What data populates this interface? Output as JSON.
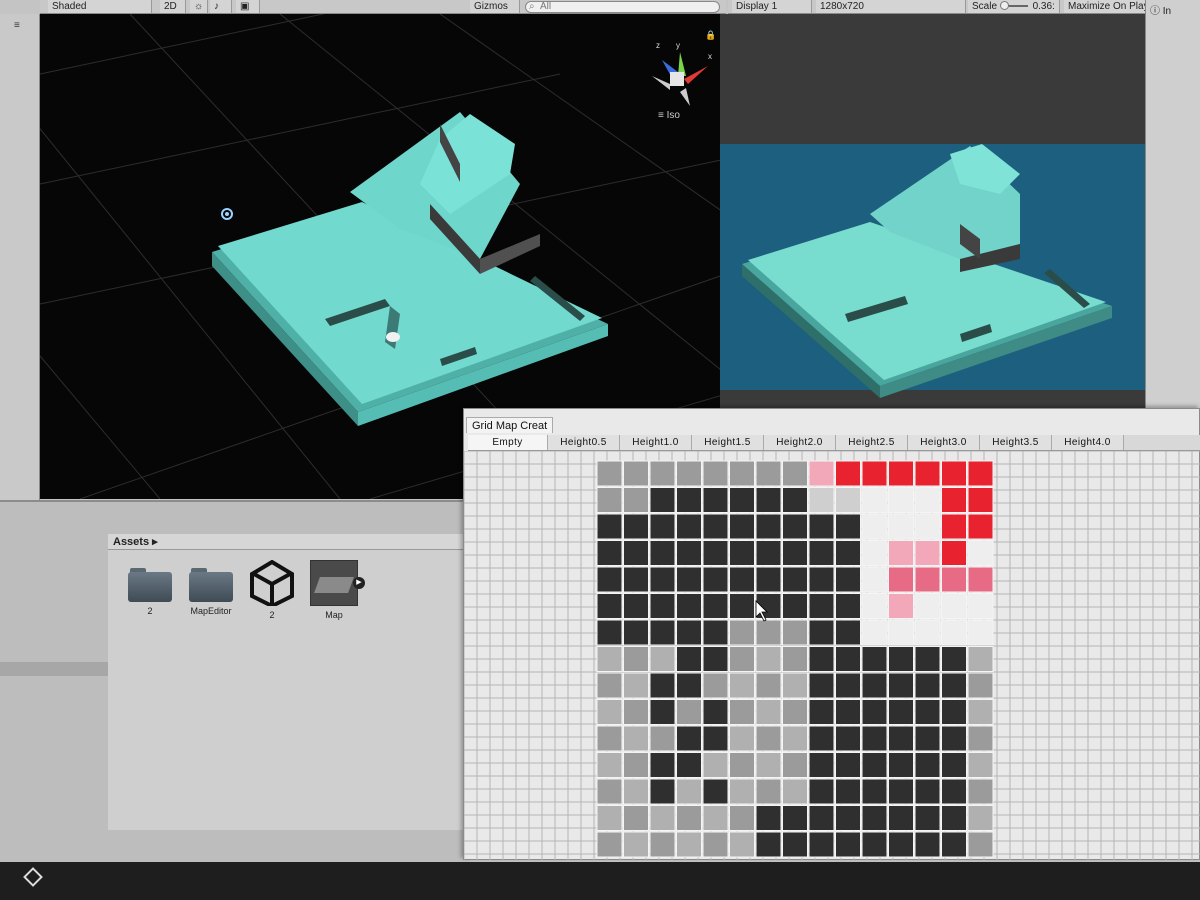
{
  "scene_toolbar": {
    "shading_mode": "Shaded",
    "mode_2d": "2D",
    "gizmos_label": "Gizmos",
    "search_placeholder": "All",
    "iso_label": "Iso",
    "axis_labels": {
      "x": "x",
      "y": "y",
      "z": "z"
    }
  },
  "game_toolbar": {
    "display": "Display 1",
    "resolution": "1280x720",
    "scale_label": "Scale",
    "scale_value": "0.36:",
    "maximize": "Maximize On Play"
  },
  "inspector_tab": "In",
  "project": {
    "header": "Assets",
    "items": [
      {
        "label": "2",
        "icon": "folder-icon"
      },
      {
        "label": "MapEditor",
        "icon": "folder-icon"
      },
      {
        "label": "2",
        "icon": "unity-scene-icon"
      },
      {
        "label": "Map",
        "icon": "prefab-icon"
      }
    ]
  },
  "grid_window": {
    "title": "Grid Map Creat",
    "tabs": [
      "Empty",
      "Height0.5",
      "Height1.0",
      "Height1.5",
      "Height2.0",
      "Height2.5",
      "Height3.0",
      "Height3.5",
      "Height4.0"
    ],
    "selected_tab": 0
  },
  "colors": {
    "map_cyan": "#6fd8cf",
    "sky_blue": "#1d5f7e",
    "height_high": "#2f2f2f",
    "height_mid": "#9b9b9b",
    "height_low": "#cfcfcf",
    "paint_red": "#e8222e",
    "paint_pink": "#f2a8b9"
  }
}
